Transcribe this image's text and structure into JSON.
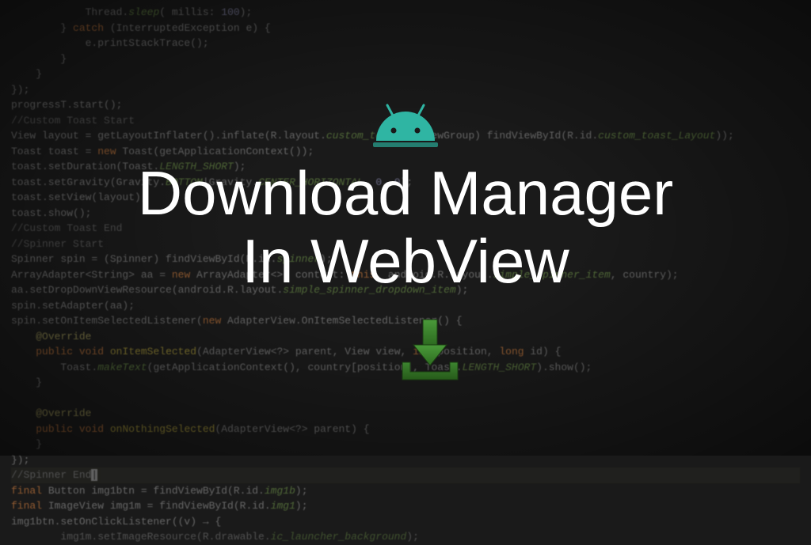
{
  "title": {
    "line1": "Download Manager",
    "line2": "In WebView"
  },
  "icons": {
    "android": "android-icon",
    "download": "download-icon"
  },
  "code_lines": [
    "            Thread.sleep( millis: 100);",
    "        } catch (InterruptedException e) {",
    "            e.printStackTrace();",
    "        }",
    "    }",
    "});",
    "progressT.start();",
    "//Custom Toast Start",
    "View layout = getLayoutInflater().inflate(R.layout.custom_toast, (ViewGroup) findViewById(R.id.custom_toast_Layout));",
    "Toast toast = new Toast(getApplicationContext());",
    "toast.setDuration(Toast.LENGTH_SHORT);",
    "toast.setGravity(Gravity.BOTTOM|Gravity.CENTER_HORIZONTAL, 0, 0);",
    "toast.setView(layout);",
    "toast.show();",
    "//Custom Toast End",
    "//Spinner Start",
    "Spinner spin = (Spinner) findViewById(R.id.spinner);",
    "ArrayAdapter<String> aa = new ArrayAdapter<>( context: this, android.R.layout.simple_spinner_item, country);",
    "aa.setDropDownViewResource(android.R.layout.simple_spinner_dropdown_item);",
    "spin.setAdapter(aa);",
    "spin.setOnItemSelectedListener(new AdapterView.OnItemSelectedListener() {",
    "    @Override",
    "    public void onItemSelected(AdapterView<?> parent, View view, int position, long id) {",
    "        Toast.makeText(getApplicationContext(), country[position], Toast.LENGTH_SHORT).show();",
    "    }",
    "",
    "    @Override",
    "    public void onNothingSelected(AdapterView<?> parent) {",
    "    }",
    "});",
    "//Spinner End|",
    "final Button img1btn = findViewById(R.id.img1b);",
    "final ImageView img1m = findViewById(R.id.img1);",
    "img1btn.setOnClickListener((v) → {",
    "        img1m.setImageResource(R.drawable.ic_launcher_background);"
  ]
}
